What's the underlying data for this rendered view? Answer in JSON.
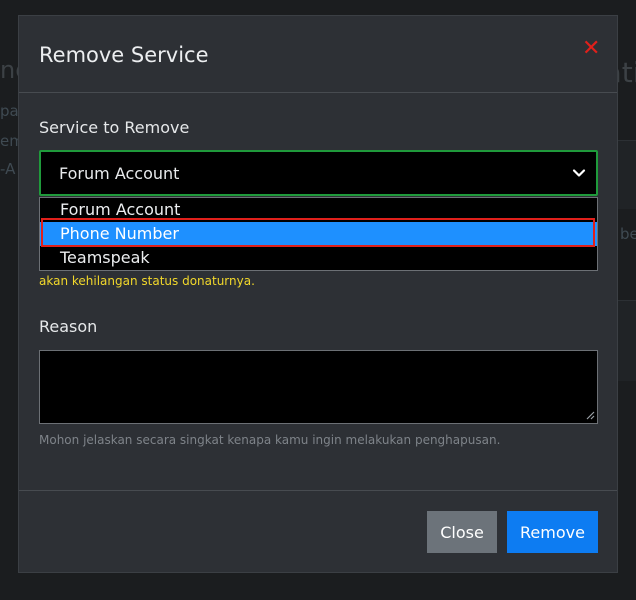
{
  "background": {
    "left_title": "ngs",
    "left_lines": [
      "pa",
      "em",
      "-A"
    ],
    "right_title": "Associatio",
    "right_text": "be"
  },
  "modal": {
    "title": "Remove Service",
    "close_icon": "close-icon",
    "service_label": "Service to Remove",
    "selected_service": "Forum Account",
    "options": [
      "Forum Account",
      "Phone Number",
      "Teamspeak"
    ],
    "highlighted_option": "Phone Number",
    "warning_text": "akan kehilangan status donaturnya.",
    "reason_label": "Reason",
    "reason_value": "",
    "help_text": "Mohon jelaskan secara singkat kenapa kamu ingin melakukan penghapusan.",
    "close_button": "Close",
    "remove_button": "Remove"
  },
  "colors": {
    "accent": "#0d7cf2",
    "selected_option": "#1e90ff",
    "valid_border": "#1f9a3b",
    "warning": "#f2d82b",
    "close_x": "#e0201b"
  }
}
